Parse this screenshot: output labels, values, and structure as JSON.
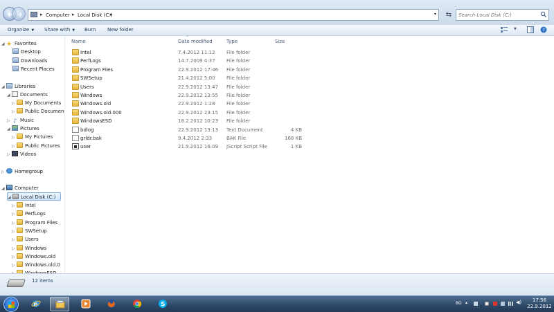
{
  "address": {
    "crumbs": [
      "Computer",
      "Local Disk (C:)"
    ],
    "search_placeholder": "Search Local Disk (C:)"
  },
  "toolbar": {
    "organize": "Organize",
    "share_with": "Share with",
    "burn": "Burn",
    "new_folder": "New folder"
  },
  "nav": {
    "favorites": "Favorites",
    "desktop": "Desktop",
    "downloads": "Downloads",
    "recent_places": "Recent Places",
    "libraries": "Libraries",
    "documents": "Documents",
    "my_documents": "My Documents",
    "public_documents": "Public Documents",
    "music": "Music",
    "pictures": "Pictures",
    "my_pictures": "My Pictures",
    "public_pictures": "Public Pictures",
    "videos": "Videos",
    "homegroup": "Homegroup",
    "computer": "Computer",
    "local_disk": "Local Disk (C:)",
    "drive_children": [
      "Intel",
      "PerfLogs",
      "Program Files",
      "SWSetup",
      "Users",
      "Windows",
      "Windows.old",
      "Windows.old.0",
      "WindowsESD"
    ]
  },
  "columns": {
    "name": "Name",
    "date_modified": "Date modified",
    "type": "Type",
    "size": "Size"
  },
  "files": [
    {
      "name": "Intel",
      "date": "7.4.2012 11:12",
      "type": "File folder",
      "size": "",
      "icon": "folder-icon"
    },
    {
      "name": "PerfLogs",
      "date": "14.7.2009 4:37",
      "type": "File folder",
      "size": "",
      "icon": "folder-icon"
    },
    {
      "name": "Program Files",
      "date": "22.9.2012 17:46",
      "type": "File folder",
      "size": "",
      "icon": "folder-icon"
    },
    {
      "name": "SWSetup",
      "date": "21.4.2012 5:00",
      "type": "File folder",
      "size": "",
      "icon": "folder-icon"
    },
    {
      "name": "Users",
      "date": "22.9.2012 13:47",
      "type": "File folder",
      "size": "",
      "icon": "folder-icon"
    },
    {
      "name": "Windows",
      "date": "22.9.2012 13:55",
      "type": "File folder",
      "size": "",
      "icon": "folder-icon"
    },
    {
      "name": "Windows.old",
      "date": "22.9.2012 1:28",
      "type": "File folder",
      "size": "",
      "icon": "folder-icon"
    },
    {
      "name": "Windows.old.000",
      "date": "22.9.2012 23:15",
      "type": "File folder",
      "size": "",
      "icon": "folder-icon"
    },
    {
      "name": "WindowsESD",
      "date": "18.2.2012 10:23",
      "type": "File folder",
      "size": "",
      "icon": "folder-icon"
    },
    {
      "name": "bdlog",
      "date": "22.9.2012 13:13",
      "type": "Text Document",
      "size": "4 KB",
      "icon": "text-file-icon"
    },
    {
      "name": "grldr.bak",
      "date": "9.4.2012 2:33",
      "type": "BAK File",
      "size": "168 KB",
      "icon": "bak-file-icon"
    },
    {
      "name": "user",
      "date": "21.9.2012 16:09",
      "type": "JScript Script File",
      "size": "1 KB",
      "icon": "script-file-icon"
    }
  ],
  "status": {
    "item_count": "12 items"
  },
  "tray": {
    "language": "BG",
    "time": "17:56",
    "date": "22.9.2012"
  },
  "colors": {
    "folder": "#e8b53a",
    "taskbar": "#2c4766",
    "selection": "#cfe6fb"
  }
}
